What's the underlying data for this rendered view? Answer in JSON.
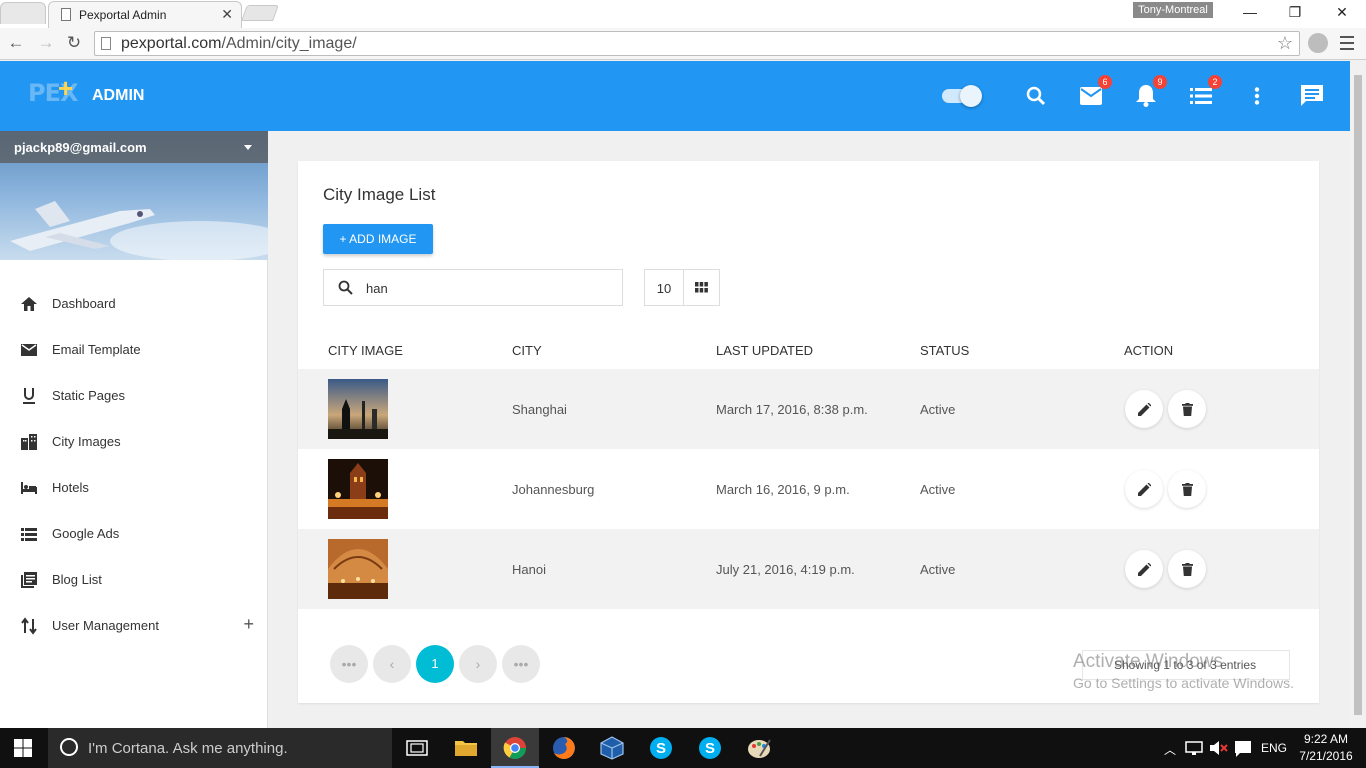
{
  "browser": {
    "tab_title": "Pexportal Admin",
    "tab_close": "✕",
    "window_user": "Tony-Montreal",
    "url_host": "pexportal.com",
    "url_path": "/Admin/city_image/"
  },
  "header": {
    "logo_text": "PEX",
    "logo_plus": "+",
    "title": "ADMIN",
    "mail_badge": "6",
    "notifications_badge": "9",
    "tasks_badge": "2",
    "accent_color": "#2196f3"
  },
  "sidebar": {
    "email": "pjackp89@gmail.com",
    "items": [
      {
        "label": "Dashboard",
        "icon": "home-icon"
      },
      {
        "label": "Email Template",
        "icon": "email-icon"
      },
      {
        "label": "Static Pages",
        "icon": "underline-icon"
      },
      {
        "label": "City Images",
        "icon": "city-icon"
      },
      {
        "label": "Hotels",
        "icon": "hotel-icon"
      },
      {
        "label": "Google Ads",
        "icon": "list-icon"
      },
      {
        "label": "Blog List",
        "icon": "blog-icon"
      },
      {
        "label": "User Management",
        "icon": "swap-icon"
      }
    ],
    "expand_symbol": "+"
  },
  "main": {
    "title": "City Image List",
    "add_button": "+ ADD IMAGE",
    "search_value": "han",
    "page_size": "10",
    "columns": [
      "CITY IMAGE",
      "CITY",
      "LAST UPDATED",
      "STATUS",
      "ACTION"
    ],
    "rows": [
      {
        "city": "Shanghai",
        "last_updated": "March 17, 2016, 8:38 p.m.",
        "status": "Active"
      },
      {
        "city": "Johannesburg",
        "last_updated": "March 16, 2016, 9 p.m.",
        "status": "Active"
      },
      {
        "city": "Hanoi",
        "last_updated": "July 21, 2016, 4:19 p.m.",
        "status": "Active"
      }
    ],
    "pagination": {
      "first": "•••",
      "prev": "‹",
      "current": "1",
      "next": "›",
      "last": "•••"
    },
    "entries_text": "Showing 1 to 3 of 3 entries"
  },
  "watermark": {
    "line1": "Activate Windows",
    "line2": "Go to Settings to activate Windows."
  },
  "taskbar": {
    "cortana_text": "I'm Cortana. Ask me anything.",
    "language": "ENG",
    "time": "9:22 AM",
    "date": "7/21/2016"
  }
}
